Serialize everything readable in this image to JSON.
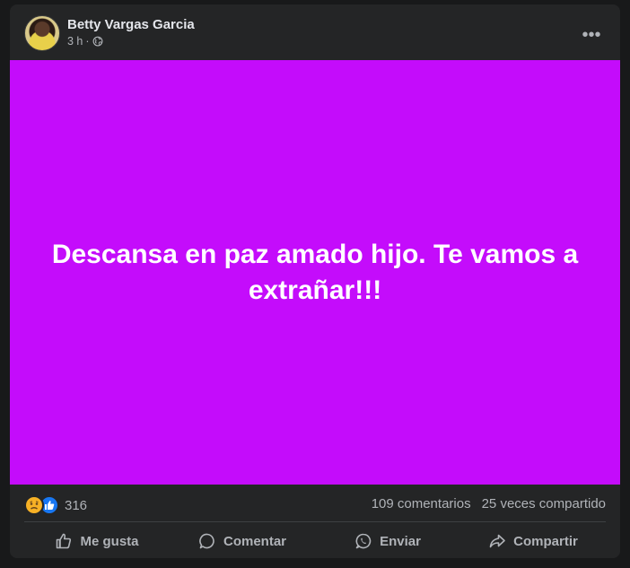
{
  "post": {
    "author": "Betty Vargas Garcia",
    "time": "3 h",
    "separator": "·",
    "privacy_icon": "globe-icon",
    "more_label": "•••",
    "text": "Descansa en paz amado hijo. Te vamos a extrañar!!!",
    "background_color": "#c40cfb"
  },
  "stats": {
    "reaction_icons": [
      "sad-reaction-icon",
      "like-reaction-icon"
    ],
    "reaction_count": "316",
    "comments": "109 comentarios",
    "shares": "25 veces compartido"
  },
  "actions": {
    "like": "Me gusta",
    "comment": "Comentar",
    "send": "Enviar",
    "share": "Compartir"
  }
}
